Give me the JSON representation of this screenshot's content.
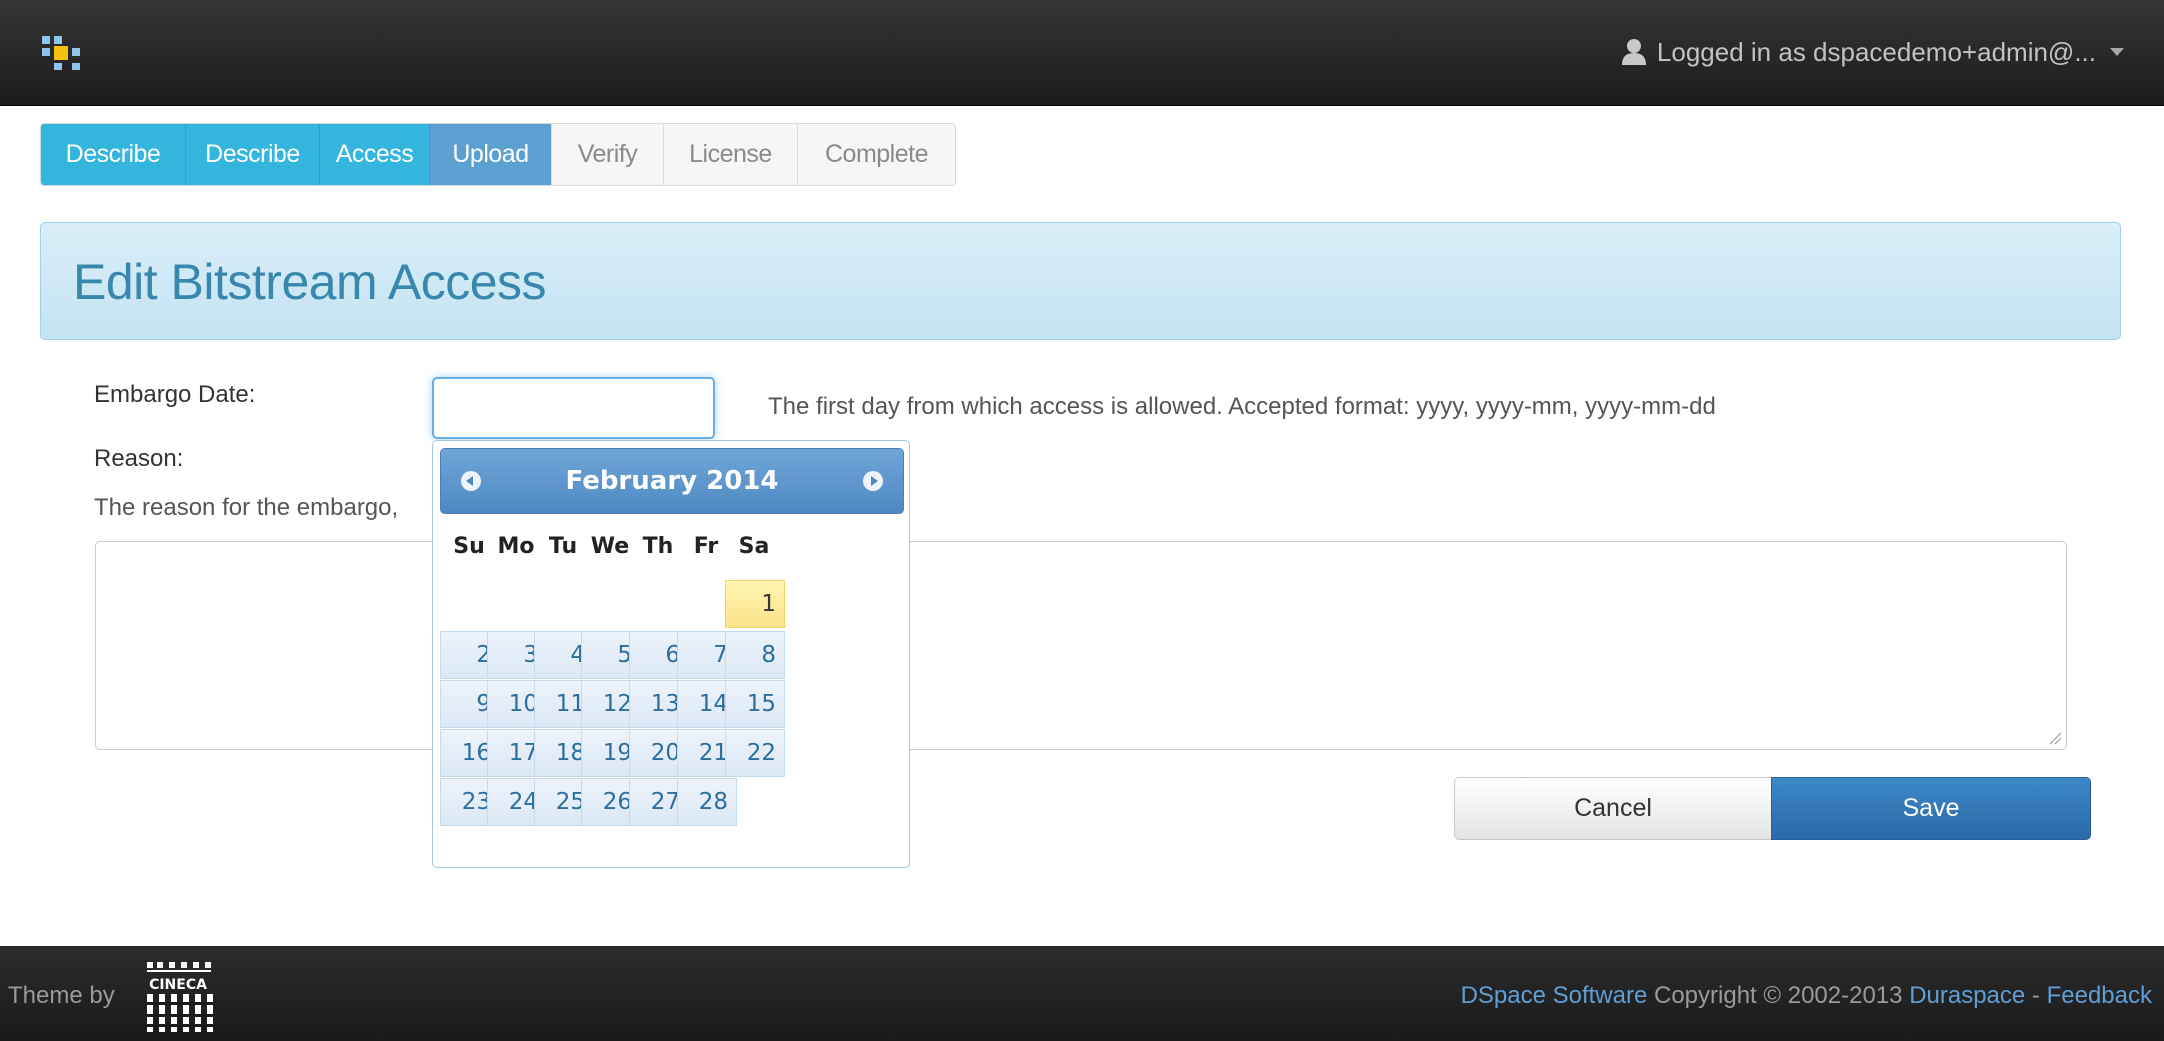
{
  "navbar": {
    "logo_icon": "dspace-logo-icon",
    "user_menu_label": "Logged in as dspacedemo+admin@...",
    "user_icon": "user-icon",
    "caret_icon": "caret-down-icon"
  },
  "steps": [
    {
      "label": "Describe",
      "state": "done"
    },
    {
      "label": "Describe",
      "state": "done"
    },
    {
      "label": "Access",
      "state": "done"
    },
    {
      "label": "Upload",
      "state": "current"
    },
    {
      "label": "Verify",
      "state": "todo"
    },
    {
      "label": "License",
      "state": "todo"
    },
    {
      "label": "Complete",
      "state": "todo"
    }
  ],
  "page": {
    "title": "Edit Bitstream Access"
  },
  "form": {
    "embargo_label": "Embargo Date:",
    "embargo_value": "",
    "embargo_help": "The first day from which access is allowed. Accepted format: yyyy, yyyy-mm, yyyy-mm-dd",
    "reason_label": "Reason:",
    "reason_help": "The reason for the embargo,",
    "reason_value": "",
    "cancel_label": "Cancel",
    "save_label": "Save"
  },
  "datepicker": {
    "title": "February 2014",
    "prev_icon": "chevron-left-icon",
    "next_icon": "chevron-right-icon",
    "weekdays": [
      "Su",
      "Mo",
      "Tu",
      "We",
      "Th",
      "Fr",
      "Sa"
    ],
    "highlighted_day": "1",
    "weeks": [
      [
        "",
        "",
        "",
        "",
        "",
        "",
        "1"
      ],
      [
        "2",
        "3",
        "4",
        "5",
        "6",
        "7",
        "8"
      ],
      [
        "9",
        "10",
        "11",
        "12",
        "13",
        "14",
        "15"
      ],
      [
        "16",
        "17",
        "18",
        "19",
        "20",
        "21",
        "22"
      ],
      [
        "23",
        "24",
        "25",
        "26",
        "27",
        "28",
        ""
      ]
    ]
  },
  "footer": {
    "theme_by": "Theme by",
    "logo_text": "CINECA",
    "dspace_link": "DSpace Software",
    "copyright": "Copyright © 2002-2013",
    "duraspace_link": "Duraspace",
    "separator": "-",
    "feedback_link": "Feedback"
  },
  "colors": {
    "navbar_bg": "#1c1c1c",
    "step_done": "#33b5de",
    "step_current": "#5c9fd1",
    "heading_text": "#3a87ad",
    "save_button": "#2a6aa8",
    "link": "#5f9fd6"
  }
}
